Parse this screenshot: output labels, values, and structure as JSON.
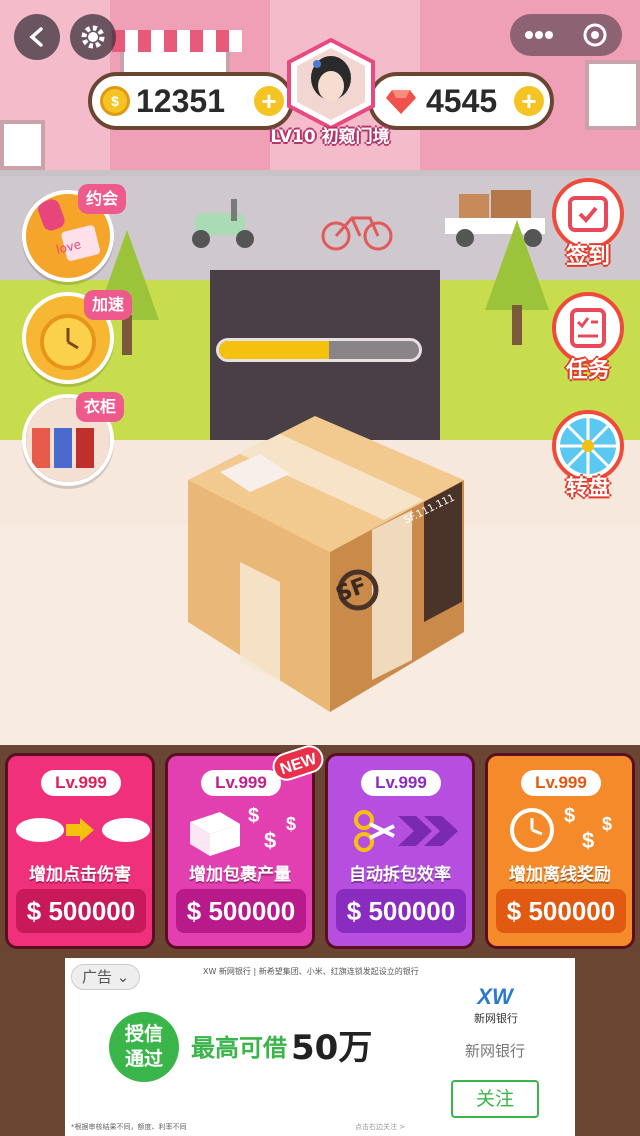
{
  "header": {
    "coins": "12351",
    "gems": "4545",
    "player_level": "LV10 初窥门境"
  },
  "side_left": [
    {
      "tag": "约会",
      "card_text": "love"
    },
    {
      "tag": "加速"
    },
    {
      "tag": "衣柜"
    }
  ],
  "side_right": [
    {
      "label": "签到"
    },
    {
      "label": "任务"
    },
    {
      "label": "转盘"
    }
  ],
  "unbox_progress": 0.55,
  "box": {
    "logo": "SF",
    "code": "SF.111.111"
  },
  "upgrades": [
    {
      "level": "Lv.999",
      "name": "增加点击伤害",
      "price": "$ 500000",
      "color": "#f0307a",
      "dark": "#c81a5a"
    },
    {
      "level": "Lv.999",
      "name": "增加包裹产量",
      "price": "$ 500000",
      "color": "#e23fb0",
      "dark": "#b81a8c",
      "badge": "NEW"
    },
    {
      "level": "Lv.999",
      "name": "自动拆包效率",
      "price": "$ 500000",
      "color": "#b64fe0",
      "dark": "#8a2cc0"
    },
    {
      "level": "Lv.999",
      "name": "增加离线奖励",
      "price": "$ 500000",
      "color": "#f48a2a",
      "dark": "#e25a12"
    }
  ],
  "ad": {
    "tag": "广告",
    "header": "XW 新网银行 | 新希望集团、小米、红旗连锁发起设立的银行",
    "badge_line1": "授信",
    "badge_line2": "通过",
    "headline": "最高可借",
    "amount": "50万",
    "brand_logo": "XW",
    "brand_small": "新网银行",
    "brand_name": "新网银行",
    "follow": "关注",
    "footnote": "*根据审核结果不同，额度、利率不同",
    "hint": "点击右边关注 >"
  }
}
